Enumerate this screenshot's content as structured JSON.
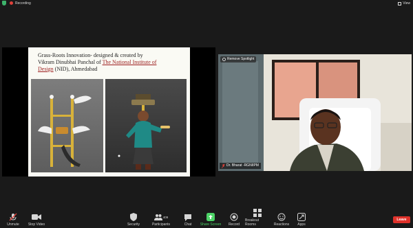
{
  "top_bar": {
    "recording_label": "Recording",
    "view_label": "View"
  },
  "slide": {
    "title_line1": "Grass-Roots Innovation- designed & created by",
    "title_line2_prefix": "Vikram Dinubhai Panchal of ",
    "title_line2_link": "The National Institute of",
    "title_line3_link": "Design",
    "title_line3_suffix": " (NID), Ahmedabad"
  },
  "video": {
    "remove_spotlight_label": "Remove Spotlight",
    "participant_name": "Dr. Bharat -RGNIIPM"
  },
  "toolbar": {
    "unmute_label": "Unmute",
    "stop_video_label": "Stop Video",
    "security_label": "Security",
    "participants_label": "Participants",
    "participants_count": "409",
    "chat_label": "Chat",
    "share_screen_label": "Share Screen",
    "record_label": "Record",
    "breakout_rooms_label": "Breakout Rooms",
    "reactions_label": "Reactions",
    "apps_label": "Apps",
    "leave_label": "Leave"
  },
  "colors": {
    "background": "#1a1a1a",
    "share_screen_green": "#4cd366",
    "leave_red": "#e0322b",
    "recording_red": "#e0413a",
    "slide_link": "#9b1b1b"
  }
}
